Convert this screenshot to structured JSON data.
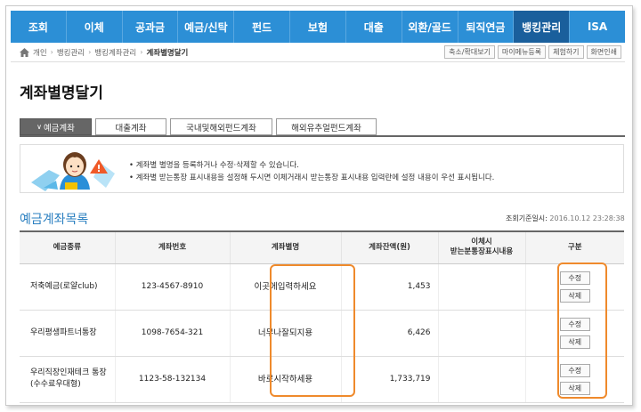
{
  "nav": {
    "items": [
      "조회",
      "이체",
      "공과금",
      "예금/신탁",
      "펀드",
      "보험",
      "대출",
      "외환/골드",
      "퇴직연금",
      "뱅킹관리",
      "ISA"
    ],
    "active_index": 9
  },
  "breadcrumb": {
    "items": [
      "개인",
      "뱅킹관리",
      "뱅킹계좌관리",
      "계좌별명달기"
    ]
  },
  "utility_buttons": [
    "축소/확대보기",
    "마이메뉴등록",
    "체험하기",
    "화면인쇄"
  ],
  "page_title": "계좌별명달기",
  "tabs": [
    "예금계좌",
    "대출계좌",
    "국내및해외펀드계좌",
    "해외유추얼펀드계좌"
  ],
  "active_tab": 0,
  "info_notes": [
    "계좌별 별명을 등록하거나 수정·삭제할 수 있습니다.",
    "계좌별 받는통장 표시내용을 설정해 두시면 이체거래시 받는통장 표시내용 입력란에 설정 내용이 우선 표시됩니다."
  ],
  "section_title": "예금계좌목록",
  "asof": {
    "label": "조회기준일시:",
    "value": "2016.10.12 23:28:38"
  },
  "table": {
    "headers": [
      "예금종류",
      "계좌번호",
      "계좌별명",
      "계좌잔액(원)",
      "이체시\n받는분통장표시내용",
      "구분"
    ],
    "rows": [
      {
        "type": "저축예금(로얄club)",
        "number": "123-4567-8910",
        "alias": "이곳에입력하세요",
        "balance": "1,453",
        "memo": "",
        "edit": "수정",
        "delete": "삭제"
      },
      {
        "type": "우리평생파트너통장",
        "number": "1098-7654-321",
        "alias": "너무나잘되지용",
        "balance": "6,426",
        "memo": "",
        "edit": "수정",
        "delete": "삭제"
      },
      {
        "type": "우리직장인재테크 통장\n(수수료우대형)",
        "number": "1123-58-132134",
        "alias": "바로시작하세용",
        "balance": "1,733,719",
        "memo": "",
        "edit": "수정",
        "delete": "삭제"
      }
    ]
  },
  "colors": {
    "nav_blue": "#2c8fd6",
    "nav_active": "#1a5f9c",
    "section_blue": "#2a7fc0",
    "highlight_orange": "#ef8a2c"
  }
}
